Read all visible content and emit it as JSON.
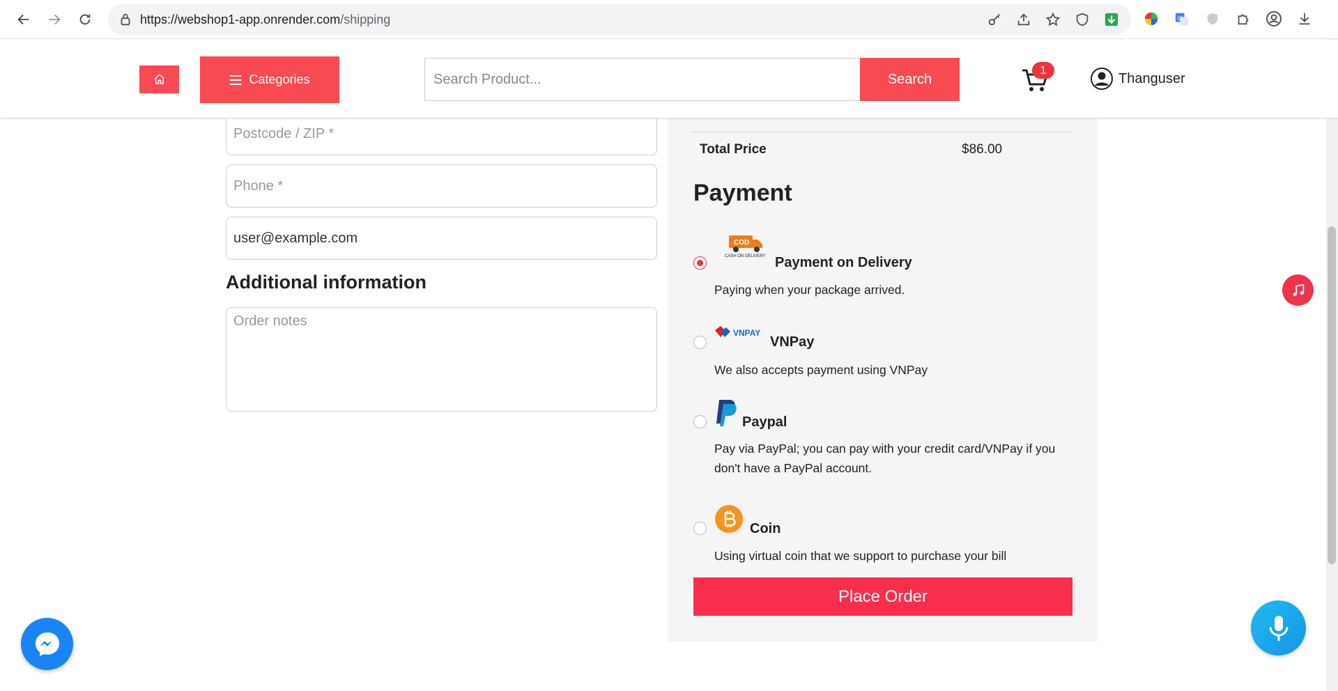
{
  "browser": {
    "url_host": "https://webshop1-app.onrender.com",
    "url_path": "/shipping"
  },
  "header": {
    "categories_label": "Categories",
    "search_placeholder": "Search Product...",
    "search_label": "Search",
    "cart_count": "1",
    "username": "Thanguser"
  },
  "form": {
    "postcode_placeholder": "Postcode / ZIP *",
    "phone_placeholder": "Phone *",
    "email_value": "user@example.com",
    "additional_title": "Additional information",
    "notes_placeholder": "Order notes"
  },
  "order": {
    "total_label": "Total Price",
    "total_value": "$86.00",
    "payment_title": "Payment",
    "place_order_label": "Place Order",
    "methods": [
      {
        "name": "Payment on Delivery",
        "desc": "Paying when your package arrived.",
        "selected": true,
        "logo_text": "COD",
        "logo_sub": "CASH ON DELIVERY"
      },
      {
        "name": "VNPay",
        "desc": "We also accepts payment using VNPay",
        "selected": false,
        "logo_text": "VNPAY"
      },
      {
        "name": "Paypal",
        "desc": "Pay via PayPal; you can pay with your credit card/VNPay if you don't have a PayPal account.",
        "selected": false
      },
      {
        "name": "Coin",
        "desc": "Using virtual coin that we support to purchase your bill",
        "selected": false
      }
    ]
  },
  "colors": {
    "brand_red": "#f84a52",
    "place_order": "#f72f4d",
    "messenger_blue": "#1a84f5",
    "mic_blue": "#1596e8"
  }
}
